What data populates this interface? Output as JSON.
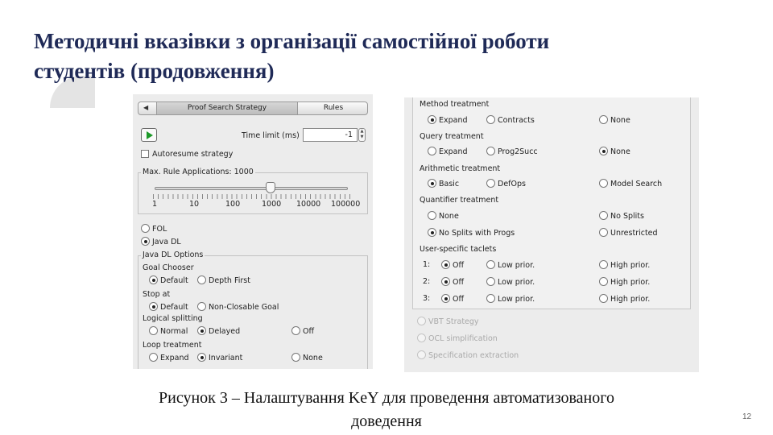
{
  "slide": {
    "title_line1": "Методичні вказівки з організації самостійної роботи",
    "title_line2": "студентів (продовження)",
    "caption_line1": "Рисунок 3 – Налаштування KeY для проведення автоматизованого",
    "caption_line2": "доведення",
    "page_number": "12"
  },
  "left_panel": {
    "tabs": {
      "active": "Proof Search Strategy",
      "other": "Rules"
    },
    "time_limit_label": "Time limit (ms)",
    "time_limit_value": "-1",
    "autoresume_label": "Autoresume strategy",
    "max_rule_label": "Max. Rule Applications: 1000",
    "slider_value": 1000,
    "slider_ticks": [
      "1",
      "10",
      "100",
      "1000",
      "10000",
      "100000"
    ],
    "mode_fol": "FOL",
    "mode_javadl": "Java DL",
    "mode_selected": "Java DL",
    "java_options_label": "Java DL Options",
    "goal_chooser": {
      "label": "Goal Chooser",
      "options": [
        "Default",
        "Depth First"
      ],
      "selected": "Default"
    },
    "stop_at": {
      "label": "Stop at",
      "options": [
        "Default",
        "Non-Closable Goal"
      ],
      "selected": "Default"
    },
    "logical_splitting": {
      "label": "Logical splitting",
      "options": [
        "Normal",
        "Delayed",
        "Off"
      ],
      "selected": "Delayed"
    },
    "loop_treatment": {
      "label": "Loop treatment",
      "options": [
        "Expand",
        "Invariant",
        "None"
      ],
      "selected": "Invariant"
    }
  },
  "right_panel": {
    "method_treatment": {
      "label": "Method treatment",
      "options": [
        "Expand",
        "Contracts",
        "None"
      ],
      "selected": "Expand"
    },
    "query_treatment": {
      "label": "Query treatment",
      "options": [
        "Expand",
        "Prog2Succ",
        "None"
      ],
      "selected": "None"
    },
    "arithmetic_treatment": {
      "label": "Arithmetic treatment",
      "options": [
        "Basic",
        "DefOps",
        "Model Search"
      ],
      "selected": "Basic"
    },
    "quantifier_treatment": {
      "label": "Quantifier treatment",
      "options": [
        "None",
        "No Splits",
        "No Splits with Progs",
        "Unrestricted"
      ],
      "selected": "No Splits with Progs"
    },
    "user_taclets": {
      "label": "User-specific taclets",
      "rows": [
        {
          "num": "1:",
          "options": [
            "Off",
            "Low prior.",
            "High prior."
          ],
          "selected": "Off"
        },
        {
          "num": "2:",
          "options": [
            "Off",
            "Low prior.",
            "High prior."
          ],
          "selected": "Off"
        },
        {
          "num": "3:",
          "options": [
            "Off",
            "Low prior.",
            "High prior."
          ],
          "selected": "Off"
        }
      ]
    },
    "disabled_options": [
      "VBT Strategy",
      "OCL simplification",
      "Specification extraction"
    ]
  }
}
